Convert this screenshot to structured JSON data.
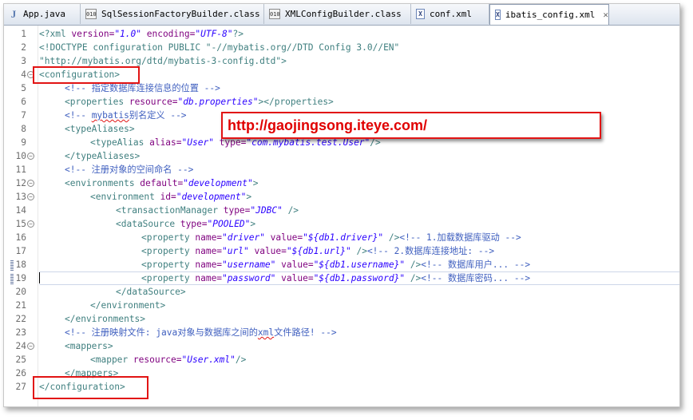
{
  "tabs": [
    {
      "label": "App.java",
      "icon": "java-file-icon",
      "active": false
    },
    {
      "label": "SqlSessionFactoryBuilder.class",
      "icon": "class-file-icon",
      "active": false
    },
    {
      "label": "XMLConfigBuilder.class",
      "icon": "class-file-icon",
      "active": false
    },
    {
      "label": "conf.xml",
      "icon": "xml-file-icon",
      "active": false
    },
    {
      "label": "ibatis_config.xml",
      "icon": "xml-file-icon",
      "active": true
    }
  ],
  "watermark": "http://gaojingsong.iteye.com/",
  "line_numbers": [
    "1",
    "2",
    "3",
    "4",
    "5",
    "6",
    "7",
    "8",
    "9",
    "10",
    "11",
    "12",
    "13",
    "14",
    "15",
    "16",
    "17",
    "18",
    "19",
    "20",
    "21",
    "22",
    "23",
    "24",
    "25",
    "26",
    "27"
  ],
  "code": {
    "l1": [
      "<?xml ",
      "version=",
      "\"1.0\"",
      " encoding=",
      "\"UTF-8\"",
      "?>"
    ],
    "l2": "<!DOCTYPE configuration PUBLIC \"-//mybatis.org//DTD Config 3.0//EN\"",
    "l3": "\"http://mybatis.org/dtd/mybatis-3-config.dtd\">",
    "l4": "<configuration>",
    "l5": "<!-- 指定数据库连接信息的位置 -->",
    "l6": [
      "<properties ",
      "resource=",
      "\"db.properties\"",
      "></properties>"
    ],
    "l7a": "<!-- ",
    "l7b": "mybatis",
    "l7c": "别名定义 -->",
    "l8": "<typeAliases>",
    "l9": [
      "<typeAlias ",
      "alias=",
      "\"User\"",
      " type=",
      "\"com.mybatis.test.User\"",
      "/>"
    ],
    "l10": "</typeAliases>",
    "l11": "<!-- 注册对象的空间命名 -->",
    "l12": [
      "<environments ",
      "default=",
      "\"development\"",
      ">"
    ],
    "l13": [
      "<environment ",
      "id=",
      "\"development\"",
      ">"
    ],
    "l14": [
      "<transactionManager ",
      "type=",
      "\"JDBC\"",
      " />"
    ],
    "l15": [
      "<dataSource ",
      "type=",
      "\"POOLED\"",
      ">"
    ],
    "l16": [
      "<property ",
      "name=",
      "\"driver\"",
      " value=",
      "\"${db1.driver}\"",
      " />",
      "<!-- 1.加载数据库驱动 -->"
    ],
    "l17": [
      "<property ",
      "name=",
      "\"url\"",
      " value=",
      "\"${db1.url}\"",
      " />",
      "<!-- 2.数据库连接地址: -->"
    ],
    "l18": [
      "<property ",
      "name=",
      "\"username\"",
      " value=",
      "\"${db1.username}\"",
      " />",
      "<!-- 数据库用户... -->"
    ],
    "l19": [
      "<property ",
      "name=",
      "\"password\"",
      " value=",
      "\"${db1.password}\"",
      " />",
      "<!-- 数据库密码... -->"
    ],
    "l20": "</dataSource>",
    "l21": "</environment>",
    "l22": "</environments>",
    "l23a": "<!-- 注册映射文件: java对象与数据库之间的",
    "l23b": "xml",
    "l23c": "文件路径! -->",
    "l24": "<mappers>",
    "l25": [
      "<mapper ",
      "resource=",
      "\"User.xml\"",
      "/>"
    ],
    "l26": "</mappers>",
    "l27": "</configuration>"
  },
  "colors": {
    "tag": "#3f7f7f",
    "attribute": "#7f007f",
    "string": "#2a00ff",
    "comment": "#3f5fbf",
    "highlight_box": "#e21414"
  }
}
